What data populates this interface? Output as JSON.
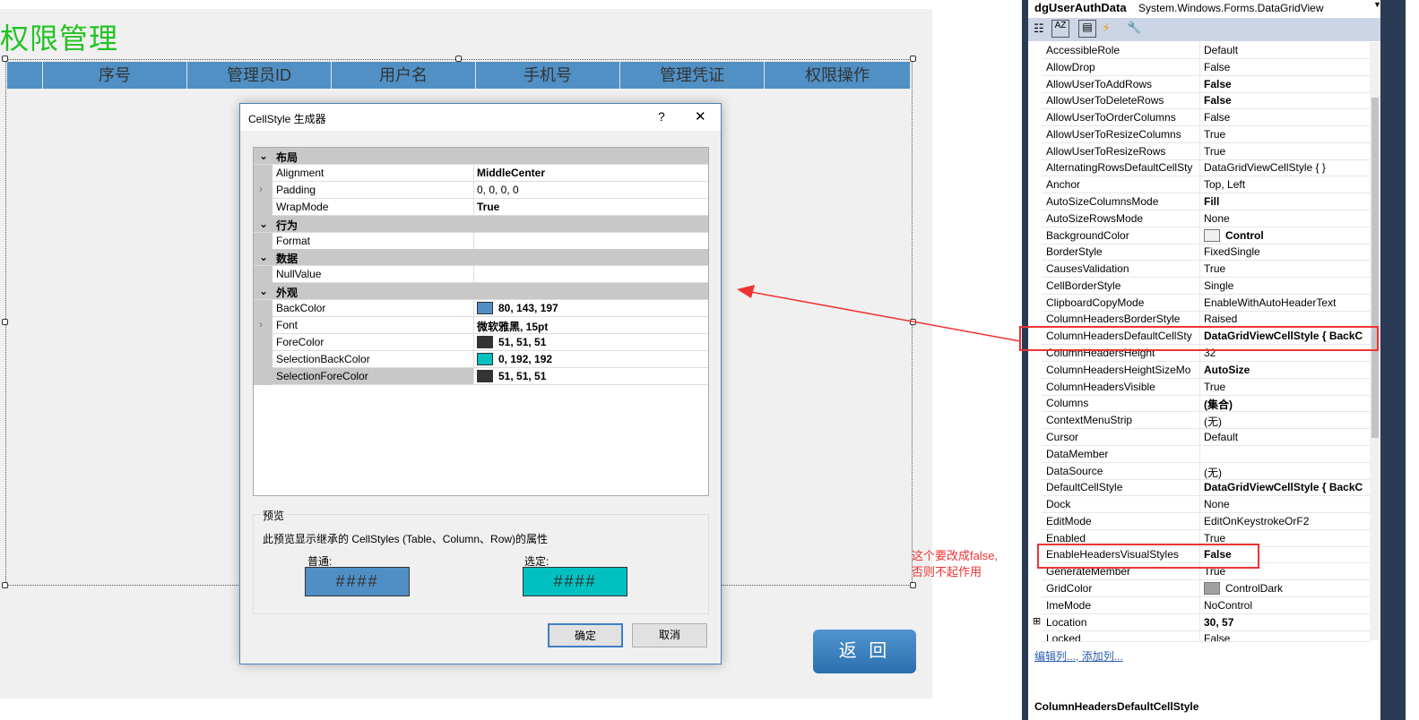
{
  "form": {
    "title": "权限管理",
    "columns": [
      "",
      "序号",
      "管理员ID",
      "用户名",
      "手机号",
      "管理凭证",
      "权限操作"
    ],
    "back_button": "返 回"
  },
  "dialog": {
    "title": "CellStyle 生成器",
    "help": "?",
    "close": "✕",
    "rows": [
      {
        "cat": "布局"
      },
      {
        "name": "Alignment",
        "value": "MiddleCenter",
        "bold": true
      },
      {
        "name": "Padding",
        "value": "0, 0, 0, 0",
        "expand": true
      },
      {
        "name": "WrapMode",
        "value": "True",
        "bold": true
      },
      {
        "cat": "行为"
      },
      {
        "name": "Format",
        "value": ""
      },
      {
        "cat": "数据"
      },
      {
        "name": "NullValue",
        "value": ""
      },
      {
        "cat": "外观"
      },
      {
        "name": "BackColor",
        "value": "80, 143, 197",
        "bold": true,
        "color": "#508fc5"
      },
      {
        "name": "Font",
        "value": "微软雅黑, 15pt",
        "bold": true,
        "expand": true
      },
      {
        "name": "ForeColor",
        "value": "51, 51, 51",
        "bold": true,
        "color": "#333333"
      },
      {
        "name": "SelectionBackColor",
        "value": "0, 192, 192",
        "bold": true,
        "color": "#00c0c0"
      },
      {
        "name": "SelectionForeColor",
        "value": "51, 51, 51",
        "bold": true,
        "color": "#333333",
        "selected": true
      }
    ],
    "preview": {
      "legend": "预览",
      "desc": "此预览显示继承的 CellStyles (Table、Column、Row)的属性",
      "normal_label": "普通:",
      "selected_label": "选定:",
      "sample": "####",
      "normal_color": "#508fc5",
      "selected_color": "#00c0c0"
    },
    "ok": "确定",
    "cancel": "取消"
  },
  "properties": {
    "object_name": "dgUserAuthData",
    "object_type": "System.Windows.Forms.DataGridView",
    "rows": [
      [
        "AccessibleRole",
        "Default",
        0
      ],
      [
        "AllowDrop",
        "False",
        0
      ],
      [
        "AllowUserToAddRows",
        "False",
        1
      ],
      [
        "AllowUserToDeleteRows",
        "False",
        1
      ],
      [
        "AllowUserToOrderColumns",
        "False",
        0
      ],
      [
        "AllowUserToResizeColumns",
        "True",
        0
      ],
      [
        "AllowUserToResizeRows",
        "True",
        0
      ],
      [
        "AlternatingRowsDefaultCellSty",
        "DataGridViewCellStyle { }",
        0
      ],
      [
        "Anchor",
        "Top, Left",
        0
      ],
      [
        "AutoSizeColumnsMode",
        "Fill",
        1
      ],
      [
        "AutoSizeRowsMode",
        "None",
        0
      ],
      [
        "BackgroundColor",
        "Control",
        1,
        "#f0f0f0"
      ],
      [
        "BorderStyle",
        "FixedSingle",
        0
      ],
      [
        "CausesValidation",
        "True",
        0
      ],
      [
        "CellBorderStyle",
        "Single",
        0
      ],
      [
        "ClipboardCopyMode",
        "EnableWithAutoHeaderText",
        0
      ],
      [
        "ColumnHeadersBorderStyle",
        "Raised",
        0
      ],
      [
        "ColumnHeadersDefaultCellSty",
        "DataGridViewCellStyle { BackC",
        1
      ],
      [
        "ColumnHeadersHeight",
        "32",
        0
      ],
      [
        "ColumnHeadersHeightSizeMo",
        "AutoSize",
        1
      ],
      [
        "ColumnHeadersVisible",
        "True",
        0
      ],
      [
        "Columns",
        "(集合)",
        1
      ],
      [
        "ContextMenuStrip",
        "(无)",
        0
      ],
      [
        "Cursor",
        "Default",
        0
      ],
      [
        "DataMember",
        "",
        0
      ],
      [
        "DataSource",
        "(无)",
        0
      ],
      [
        "DefaultCellStyle",
        "DataGridViewCellStyle { BackC",
        1
      ],
      [
        "Dock",
        "None",
        0
      ],
      [
        "EditMode",
        "EditOnKeystrokeOrF2",
        0
      ],
      [
        "Enabled",
        "True",
        0
      ],
      [
        "EnableHeadersVisualStyles",
        "False",
        1
      ],
      [
        "GenerateMember",
        "True",
        0
      ],
      [
        "GridColor",
        "ControlDark",
        0,
        "#a0a0a0"
      ],
      [
        "ImeMode",
        "NoControl",
        0
      ],
      [
        "Location",
        "30, 57",
        1
      ],
      [
        "Locked",
        "False",
        0
      ]
    ],
    "links": [
      "编辑列...",
      "添加列..."
    ],
    "description_title": "ColumnHeadersDefaultCellStyle"
  },
  "annotation": {
    "line1": "这个要改成false,",
    "line2": "否则不起作用",
    "color": "#e33333"
  }
}
